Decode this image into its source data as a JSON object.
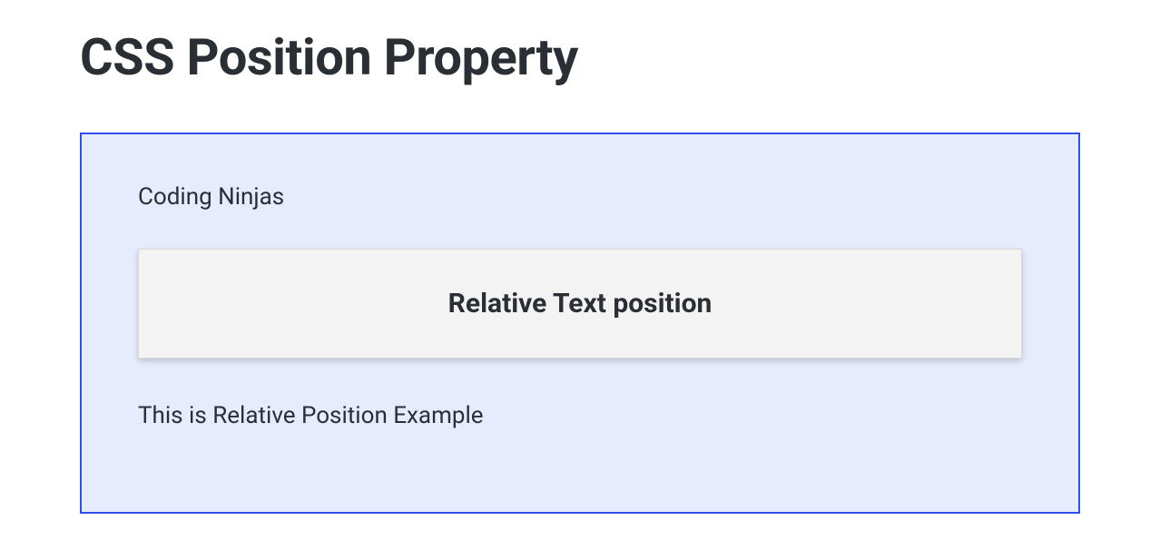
{
  "heading": "CSS Position Property",
  "container": {
    "brand": "Coding Ninjas",
    "card_text": "Relative Text position",
    "description": "This is Relative Position Example"
  }
}
